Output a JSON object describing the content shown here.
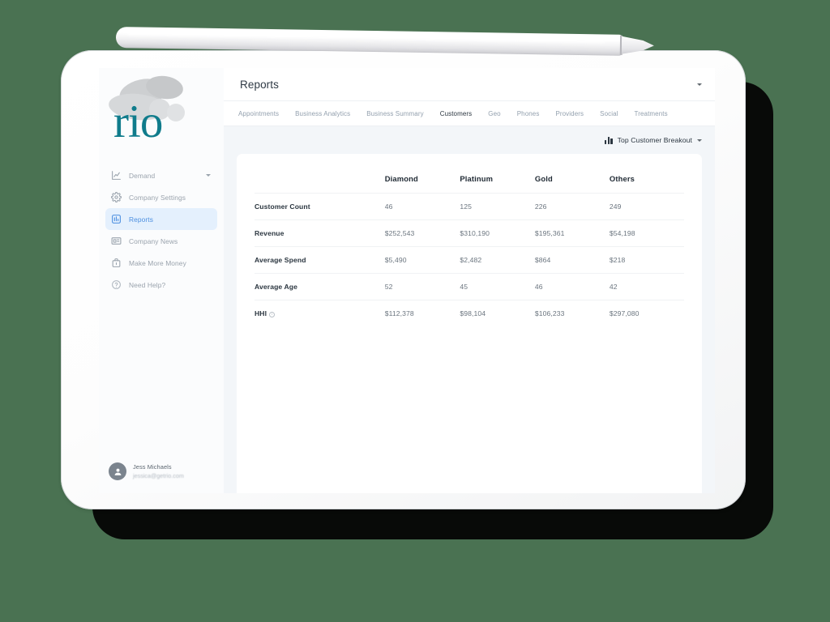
{
  "brand": {
    "logo_text": "rio",
    "logo_color": "#107c8c"
  },
  "sidebar": {
    "items": [
      {
        "label": "Demand",
        "icon": "chart-line-icon",
        "active": false,
        "has_caret": true
      },
      {
        "label": "Company Settings",
        "icon": "gear-icon",
        "active": false,
        "has_caret": false
      },
      {
        "label": "Reports",
        "icon": "report-icon",
        "active": true,
        "has_caret": false
      },
      {
        "label": "Company News",
        "icon": "news-icon",
        "active": false,
        "has_caret": false
      },
      {
        "label": "Make More Money",
        "icon": "briefcase-icon",
        "active": false,
        "has_caret": false
      },
      {
        "label": "Need Help?",
        "icon": "help-circle-icon",
        "active": false,
        "has_caret": false
      }
    ],
    "active_bg": "#e4f0fd",
    "active_color": "#4c8fe0",
    "user": {
      "name": "Jess Michaels",
      "email": "jessica@getrio.com",
      "avatar_icon": "user-avatar-icon"
    }
  },
  "header": {
    "title": "Reports",
    "caret_icon": "chevron-down-icon"
  },
  "tabs": [
    {
      "label": "Appointments",
      "active": false
    },
    {
      "label": "Business Analytics",
      "active": false
    },
    {
      "label": "Business Summary",
      "active": false
    },
    {
      "label": "Customers",
      "active": true
    },
    {
      "label": "Geo",
      "active": false
    },
    {
      "label": "Phones",
      "active": false
    },
    {
      "label": "Providers",
      "active": false
    },
    {
      "label": "Social",
      "active": false
    },
    {
      "label": "Treatments",
      "active": false
    }
  ],
  "toolbar": {
    "breakout_label": "Top Customer Breakout",
    "breakout_icon": "bar-chart-icon",
    "caret_icon": "chevron-down-icon"
  },
  "table": {
    "columns": [
      "",
      "Diamond",
      "Platinum",
      "Gold",
      "Others"
    ],
    "rows": [
      {
        "label": "Customer Count",
        "info": false,
        "values": [
          "46",
          "125",
          "226",
          "249"
        ]
      },
      {
        "label": "Revenue",
        "info": false,
        "values": [
          "$252,543",
          "$310,190",
          "$195,361",
          "$54,198"
        ]
      },
      {
        "label": "Average Spend",
        "info": false,
        "values": [
          "$5,490",
          "$2,482",
          "$864",
          "$218"
        ]
      },
      {
        "label": "Average Age",
        "info": false,
        "values": [
          "52",
          "45",
          "46",
          "42"
        ]
      },
      {
        "label": "HHI",
        "info": true,
        "values": [
          "$112,378",
          "$98,104",
          "$106,233",
          "$297,080"
        ]
      }
    ]
  },
  "scene": {
    "background_color": "#4a7252",
    "device": "tablet",
    "stylus": "white-stylus"
  }
}
